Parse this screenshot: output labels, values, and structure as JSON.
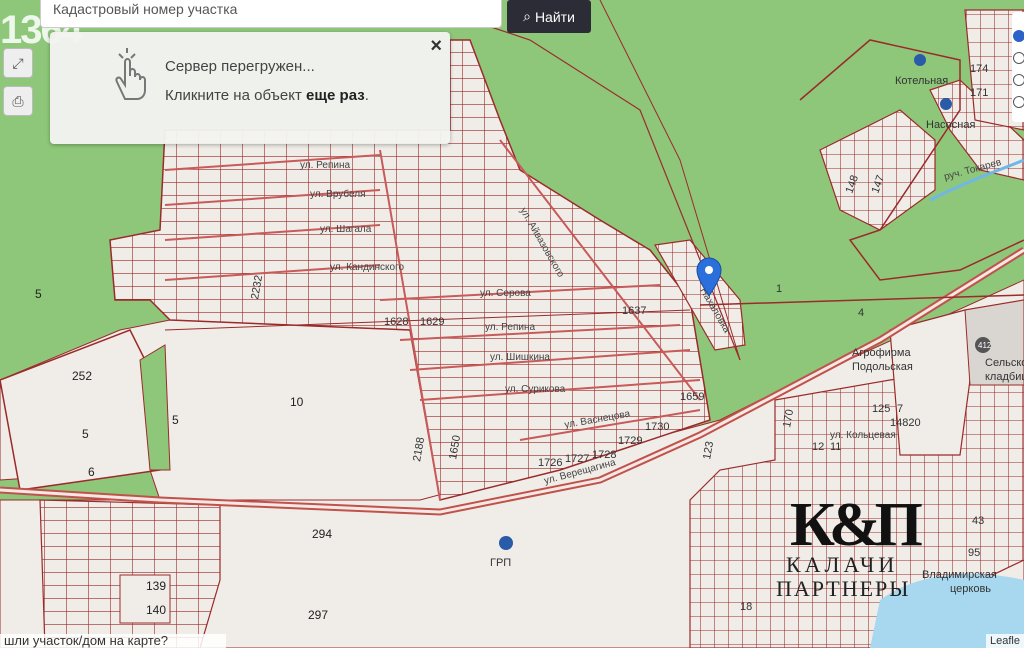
{
  "badge": "1364",
  "search": {
    "placeholder": "Кадастровый номер участка",
    "button_label": "Найти"
  },
  "popup": {
    "line1": "Сервер перегружен...",
    "line2_prefix": "Кликните на объект",
    "line2_bold": "еще раз",
    "line2_suffix": ".",
    "close": "×"
  },
  "bottom_link": "шли участок/дом на карте?",
  "attribution": "Leafle",
  "colors": {
    "forest": "#8ec77a",
    "field": "#f0ede8",
    "parcel": "#9b2a2a",
    "road": "#c0524a",
    "water": "#a8d8f0",
    "marker": "#2a6fdb"
  },
  "map": {
    "streets": [
      "ул. Репина",
      "ул. Врубеля",
      "ул. Шагала",
      "ул. Кандинского",
      "ул. Айвазовского",
      "ул. Серова",
      "ул. Репина",
      "ул. Шишкина",
      "ул. Сурикова",
      "ул. Васнецова",
      "ул. Верещагина",
      "ул. Кольцевая",
      "руч. Токарев",
      "Нахаловка"
    ],
    "labels": {
      "l252": "252",
      "l5a": "5",
      "l5b": "5",
      "l5c": "5",
      "l6": "6",
      "l10": "10",
      "l2232": "2232",
      "l1628": "1628",
      "l1629": "1629",
      "l1637": "1637",
      "l1659": "1659",
      "l1650": "1650",
      "l2188": "2188",
      "l1726": "1726",
      "l1727": "1727",
      "l1728": "1728",
      "l1729": "1729",
      "l1730": "1730",
      "l294": "294",
      "l297": "297",
      "l139": "139",
      "l140": "140",
      "l1": "1",
      "l4": "4",
      "l412": "412",
      "l125": "125",
      "l7": "7",
      "l14820": "14820",
      "l148": "148",
      "l147": "147",
      "l174": "174",
      "l171": "171",
      "l170": "170",
      "l12": "12",
      "l11": "11",
      "l123": "123",
      "l18": "18",
      "l43": "43",
      "l95": "95"
    },
    "poi": {
      "kotelnaya": "Котельная",
      "nasosnaya": "Насосная",
      "grp": "ГРП",
      "agro1": "Агрофирма",
      "agro2": "Подольская",
      "cem1": "Сельское",
      "cem2": "кладбище",
      "vlad": "Владимирская",
      "cerk": "церковь"
    }
  },
  "logo": {
    "mark": "К&П",
    "line1": "КАЛАЧИ",
    "line2": "ПАРТНЕРЫ"
  }
}
